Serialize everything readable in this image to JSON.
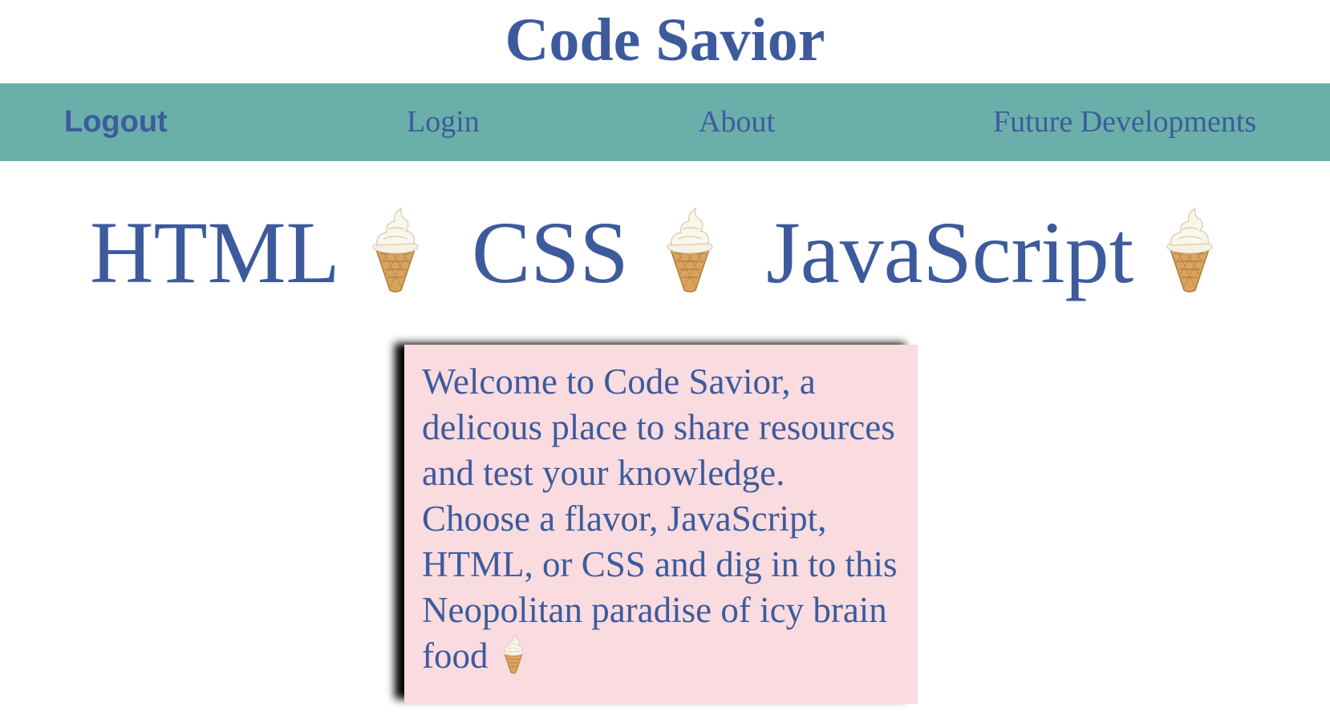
{
  "site": {
    "title": "Code Savior"
  },
  "nav": {
    "logout": "Logout",
    "login": "Login",
    "about": "About",
    "future": "Future Developments"
  },
  "flavors": {
    "html": "HTML",
    "css": "CSS",
    "javascript": "JavaScript"
  },
  "welcome": {
    "text": "Welcome to Code Savior, a delicous place to share resources and test your knowledge. Choose a flavor, JavaScript, HTML, or CSS and dig in to this Neopolitan paradise of icy brain food"
  },
  "icons": {
    "flavor_separator": "soft-ice-cream-icon",
    "welcome_end": "soft-ice-cream-icon"
  },
  "colors": {
    "text": "#3d5b9c",
    "navbar": "#6aafaa",
    "card_background": "#f9dbe0",
    "card_shadow": "#000000"
  }
}
